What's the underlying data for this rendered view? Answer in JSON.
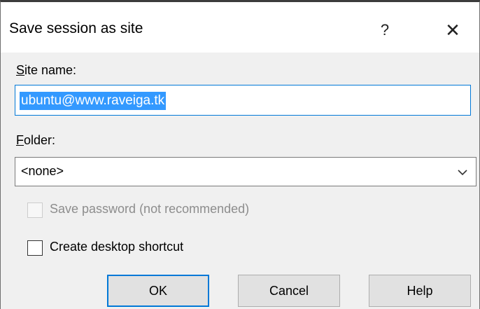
{
  "dialog": {
    "title": "Save session as site",
    "help_glyph": "?",
    "close_glyph": "✕"
  },
  "site_name": {
    "label": "Site name:",
    "value": "ubuntu@www.raveiga.tk"
  },
  "folder": {
    "label": "Folder:",
    "value": "<none>",
    "chevron_icon": "chevron-down-icon"
  },
  "options": {
    "save_password": {
      "label": "Save password (not recommended)",
      "checked": false,
      "enabled": false
    },
    "desktop_shortcut": {
      "label": "Create desktop shortcut",
      "checked": false,
      "enabled": true
    }
  },
  "buttons": {
    "ok": "OK",
    "cancel": "Cancel",
    "help": "Help"
  },
  "colors": {
    "accent": "#0078d7",
    "selection": "#3399ff",
    "dialog_bg": "#f0f0f0",
    "disabled_text": "#8d8d8d"
  }
}
